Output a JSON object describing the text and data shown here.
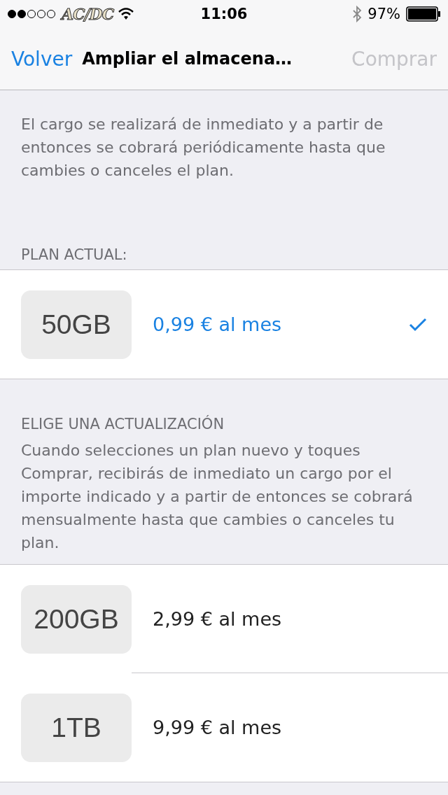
{
  "status_bar": {
    "carrier": "AC/DC",
    "time": "11:06",
    "battery": "97%"
  },
  "nav_bar": {
    "back": "Volver",
    "title": "Ampliar el almacena…",
    "action": "Comprar",
    "action_disabled": true
  },
  "intro": "El cargo se realizará de inmediato y a partir de entonces se cobrará periódicamente hasta que cambies o canceles el plan.",
  "sections": [
    {
      "header": "PLAN ACTUAL:",
      "plans": [
        {
          "size": "50GB",
          "price": "0,99 € al mes",
          "selected": true
        }
      ]
    },
    {
      "header": "ELIGE UNA ACTUALIZACIÓN",
      "description": "Cuando selecciones un plan nuevo y toques Comprar, recibirás de inmediato un cargo por el importe indicado y a partir de entonces se cobrará mensualmente hasta que cambies o canceles tu plan.",
      "plans": [
        {
          "size": "200GB",
          "price": "2,99 € al mes",
          "selected": false
        },
        {
          "size": "1TB",
          "price": "9,99 € al mes",
          "selected": false
        }
      ]
    }
  ]
}
